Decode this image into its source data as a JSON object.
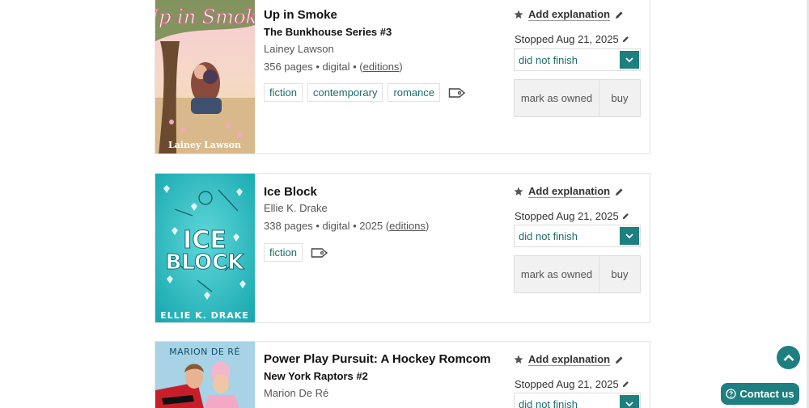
{
  "books": [
    {
      "title": "Up in Smoke",
      "series": "The Bunkhouse Series #3",
      "author": "Lainey Lawson",
      "pages_format": "356 pages • digital •",
      "editions_open": "(",
      "editions_label": "editions",
      "editions_close": ")",
      "tags": [
        "fiction",
        "contemporary",
        "romance"
      ],
      "explanation_label": "Add explanation",
      "stopped_label": "Stopped Aug 21, 2025",
      "status_value": "did not finish",
      "mark_owned_label": "mark as owned",
      "buy_label": "buy",
      "cover": {
        "title_text": "Up in Smoke",
        "author_text": "Lainey Lawson"
      }
    },
    {
      "title": "Ice Block",
      "author": "Ellie K. Drake",
      "pages_format": "338 pages • digital • 2025",
      "editions_open": "(",
      "editions_label": "editions",
      "editions_close": ")",
      "tags": [
        "fiction"
      ],
      "explanation_label": "Add explanation",
      "stopped_label": "Stopped Aug 21, 2025",
      "status_value": "did not finish",
      "mark_owned_label": "mark as owned",
      "buy_label": "buy",
      "cover": {
        "title_line1": "ICE",
        "title_line2": "BLOCK",
        "author_text": "ELLIE K. DRAKE"
      }
    },
    {
      "title": "Power Play Pursuit: A Hockey Romcom",
      "series": "New York Raptors #2",
      "author": "Marion De Ré",
      "explanation_label": "Add explanation",
      "stopped_label": "Stopped Aug 21, 2025",
      "status_value": "did not finish",
      "cover": {
        "author_text": "MARION DE RÉ"
      }
    }
  ],
  "contact_label": "Contact us",
  "colors": {
    "accent": "#1e7f80",
    "tag_text": "#1a6e6a"
  },
  "icons": [
    "star-icon",
    "pencil-icon",
    "chevron-down-icon",
    "tag-icon",
    "chevron-up-icon",
    "help-circle-icon"
  ]
}
